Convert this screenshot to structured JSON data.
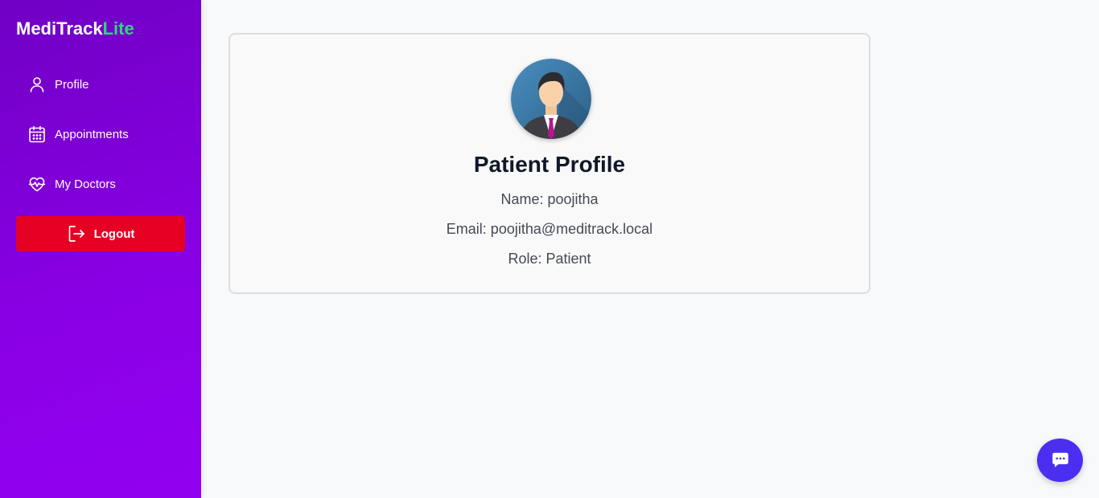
{
  "brand": {
    "name": "MediTrack",
    "accent": "Lite"
  },
  "sidebar": {
    "items": [
      {
        "label": "Profile",
        "icon": "user-icon"
      },
      {
        "label": "Appointments",
        "icon": "calendar-icon"
      },
      {
        "label": "My Doctors",
        "icon": "heart-pulse-icon"
      }
    ],
    "logout_label": "Logout"
  },
  "profile": {
    "title": "Patient Profile",
    "name_line": "Name: poojitha",
    "email_line": "Email: poojitha@meditrack.local",
    "role_line": "Role: Patient"
  },
  "chat": {
    "icon": "chat-bubble-icon"
  },
  "colors": {
    "sidebar_start": "#7000c4",
    "sidebar_end": "#9200f0",
    "brand_accent": "#2bd97a",
    "logout": "#e60023",
    "chat_button": "#4a2ff0"
  }
}
